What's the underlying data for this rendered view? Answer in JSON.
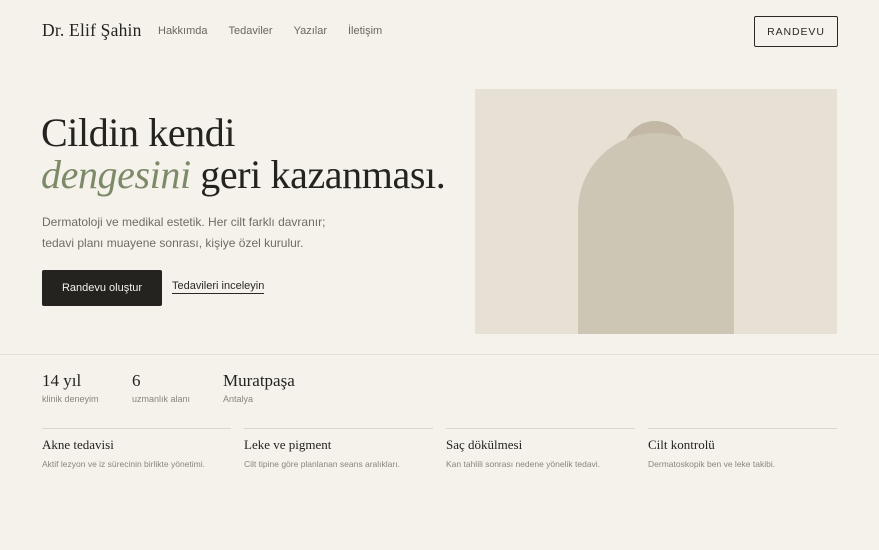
{
  "header": {
    "brand": "Dr. Elif Şahin",
    "nav": [
      "Hakkımda",
      "Tedaviler",
      "Yazılar",
      "İletişim"
    ],
    "cta_label": "RANDEVU"
  },
  "hero": {
    "title_line1": "Cildin kendi",
    "title_accent": "dengesini",
    "title_rest": " geri kazanması.",
    "text_line1": "Dermatoloji ve medikal estetik. Her cilt farklı davranır;",
    "text_line2": "tedavi planı muayene sonrası, kişiye özel kurulur.",
    "primary_button": "Randevu oluştur",
    "secondary_link": "Tedavileri inceleyin"
  },
  "stats": [
    {
      "value": "14 yıl",
      "label": "klinik deneyim"
    },
    {
      "value": "6",
      "label": "uzmanlık alanı"
    },
    {
      "value": "Muratpaşa",
      "label": "Antalya"
    }
  ],
  "services": [
    {
      "title": "Akne tedavisi",
      "desc": "Aktif lezyon ve iz sürecinin birlikte yönetimi."
    },
    {
      "title": "Leke ve pigment",
      "desc": "Cilt tipine göre planlanan seans aralıkları."
    },
    {
      "title": "Saç dökülmesi",
      "desc": "Kan tahlili sonrası nedene yönelik tedavi."
    },
    {
      "title": "Cilt kontrolü",
      "desc": "Dermatoskopik ben ve leke takibi."
    }
  ],
  "colors": {
    "background": "#f5f2ec",
    "text": "#24231f",
    "accent": "#7d8a68",
    "image_bg": "#e6e0d5",
    "arch": "#cec6b4"
  }
}
